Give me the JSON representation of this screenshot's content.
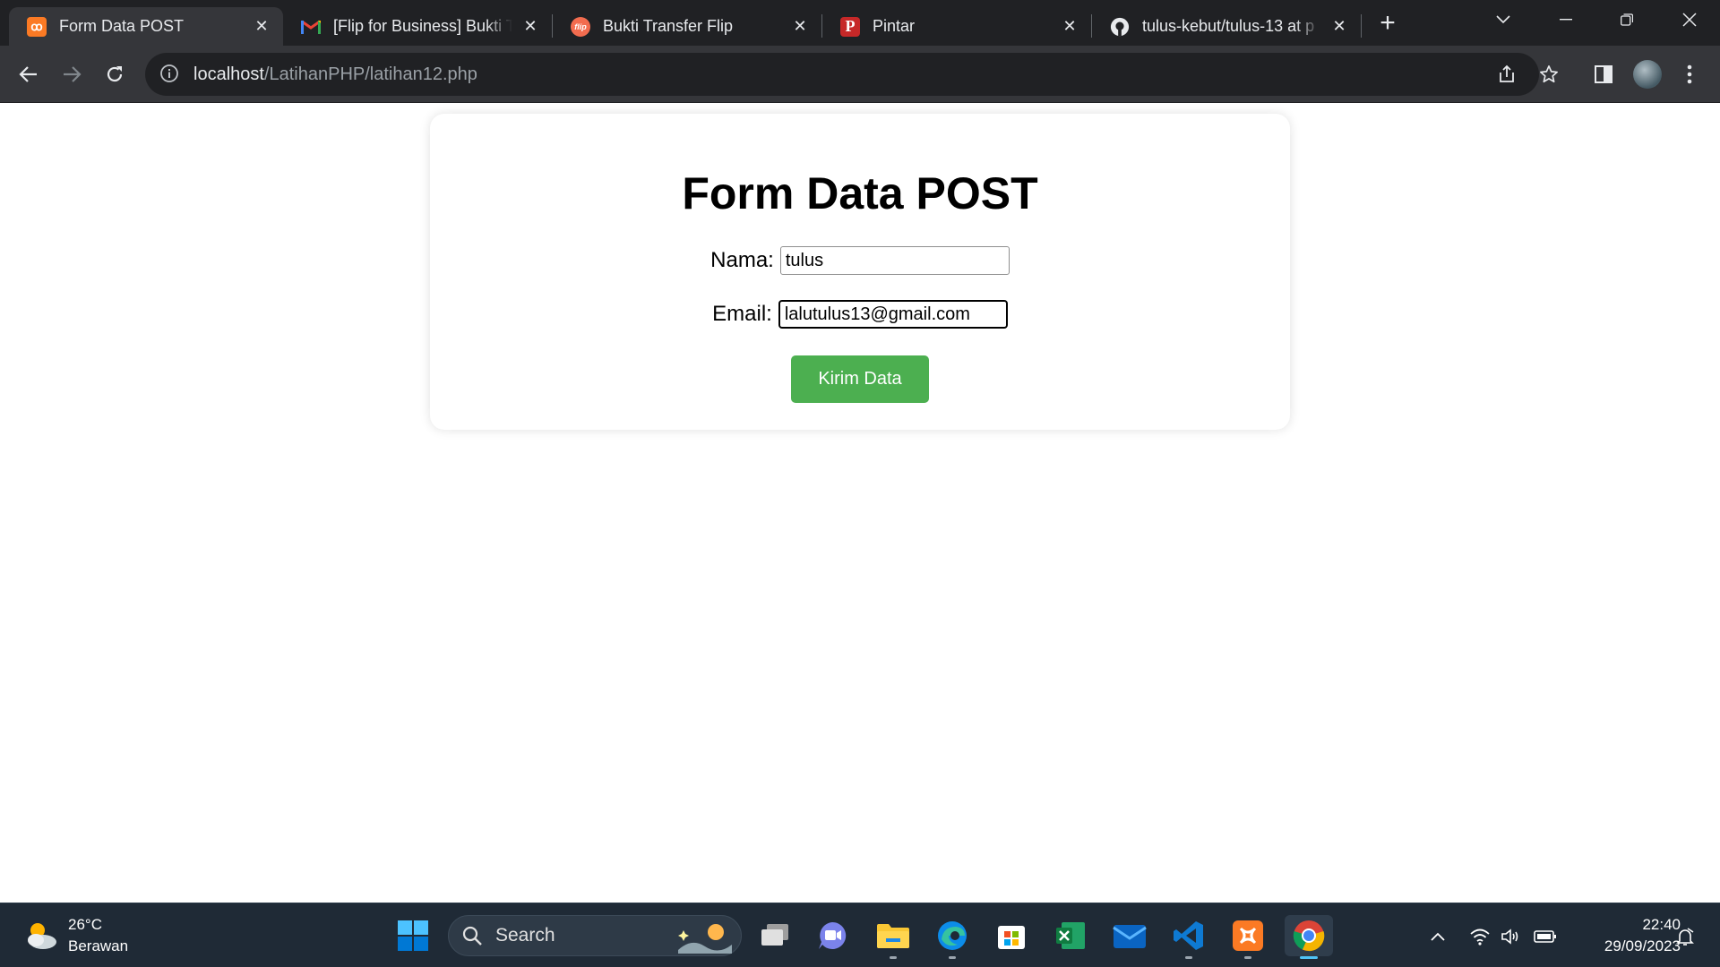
{
  "browser": {
    "tabs": [
      {
        "title": "Form Data POST",
        "favicon": "xampp-icon",
        "active": true
      },
      {
        "title": "[Flip for Business] Bukti Transfer",
        "favicon": "gmail-icon",
        "active": false
      },
      {
        "title": "Bukti Transfer Flip",
        "favicon": "flip-icon",
        "active": false
      },
      {
        "title": "Pintar",
        "favicon": "pintar-icon",
        "active": false
      },
      {
        "title": "tulus-kebut/tulus-13 at p",
        "favicon": "github-icon",
        "active": false
      }
    ],
    "url_host": "localhost",
    "url_path": "/LatihanPHP/latihan12.php"
  },
  "page": {
    "heading": "Form Data POST",
    "nama_label": "Nama:",
    "nama_value": "tulus",
    "email_label": "Email:",
    "email_value": "lalutulus13@gmail.com",
    "submit_label": "Kirim Data",
    "submit_color": "#4caf50"
  },
  "taskbar": {
    "temperature": "26°C",
    "weather": "Berawan",
    "search_placeholder": "Search",
    "time": "22:40",
    "date": "29/09/2023"
  }
}
